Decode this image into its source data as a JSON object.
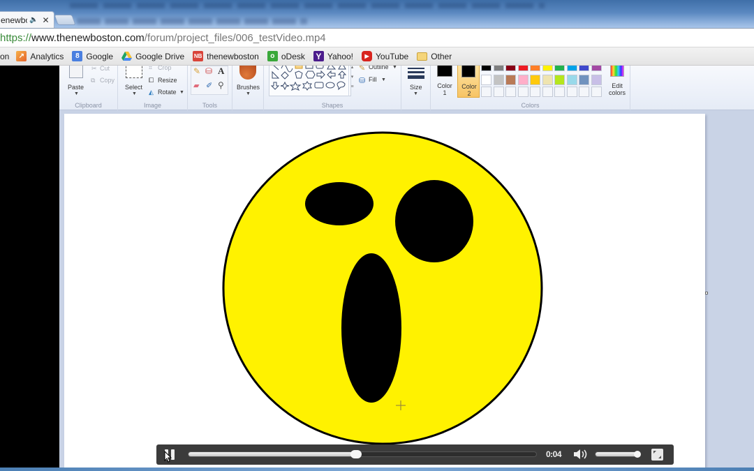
{
  "browser": {
    "tab": {
      "title": "thenewboston",
      "audio_icon": "speaker-icon",
      "close_icon": "close-icon"
    },
    "address": {
      "scheme": "https://",
      "host": "www.thenewboston.com",
      "path": "/forum/project_files/006_testVideo.mp4"
    },
    "bookmarks": [
      {
        "label": "on",
        "icon": "",
        "color": ""
      },
      {
        "label": "Analytics",
        "icon": "analytics-icon",
        "color": "#f0822b"
      },
      {
        "label": "Google",
        "icon": "google-icon",
        "glyph": "8",
        "color": "#4a7fe0"
      },
      {
        "label": "Google Drive",
        "icon": "google-drive-icon",
        "color": "#2ea35a"
      },
      {
        "label": "thenewboston",
        "icon": "thenewboston-icon",
        "glyph": "NB",
        "color": "#d9443a"
      },
      {
        "label": "oDesk",
        "icon": "odesk-icon",
        "glyph": "o",
        "color": "#3aa83a"
      },
      {
        "label": "Yahoo!",
        "icon": "yahoo-icon",
        "glyph": "Y",
        "color": "#4b1c8c"
      },
      {
        "label": "YouTube",
        "icon": "youtube-icon",
        "glyph": "▶",
        "color": "#d8241e"
      },
      {
        "label": "Other",
        "icon": "folder-icon",
        "color": "#f3c24a"
      }
    ]
  },
  "paint": {
    "clipboard": {
      "paste": "Paste",
      "cut": "Cut",
      "copy": "Copy",
      "group": "Clipboard"
    },
    "image": {
      "select": "Select",
      "crop": "Crop",
      "resize": "Resize",
      "rotate": "Rotate",
      "group": "Image"
    },
    "tools": {
      "group": "Tools"
    },
    "brushes": {
      "label": "Brushes"
    },
    "shapes": {
      "outline": "Outline",
      "fill": "Fill",
      "group": "Shapes"
    },
    "size": {
      "label": "Size"
    },
    "colors": {
      "color1_label": "Color 1",
      "color1_value": "#000000",
      "color2_label": "Color 2",
      "color2_value": "#000000",
      "selected": "Color 2",
      "edit_label": "Edit colors",
      "group": "Colors",
      "palette_row1": [
        "#000000",
        "#7f7f7f",
        "#880015",
        "#ed1c24",
        "#ff7f27",
        "#fff200",
        "#22b14c",
        "#00a2e8",
        "#3f48cc",
        "#a349a4"
      ],
      "palette_row2": [
        "#ffffff",
        "#c3c3c3",
        "#b97a57",
        "#ffaec9",
        "#ffc90e",
        "#efe4b0",
        "#b5e61d",
        "#99d9ea",
        "#7092be",
        "#c8bfe7"
      ]
    },
    "drawing": {
      "face_color": "#fff200",
      "outline_color": "#000000",
      "feature_color": "#000000"
    }
  },
  "video": {
    "state": "playing",
    "time": "0:04",
    "progress_fraction": 0.48,
    "volume_fraction": 0.95
  }
}
